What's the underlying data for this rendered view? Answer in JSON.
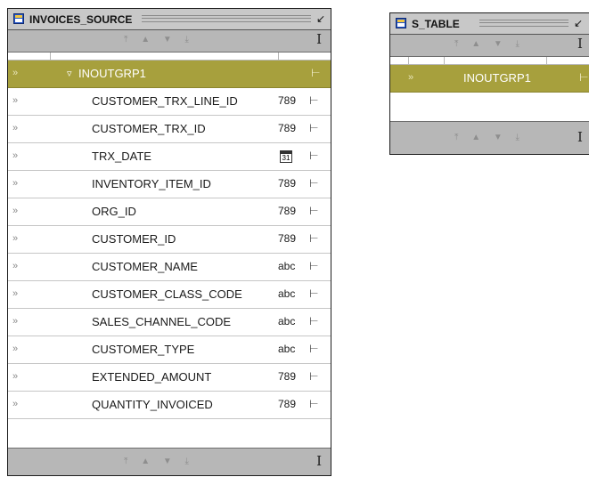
{
  "panels": {
    "invoices_source": {
      "title": "INVOICES_SOURCE",
      "nav_arrows": "⤒ ▲ ▼ ⤓",
      "cursor": "I",
      "group": {
        "toggle": "▿",
        "label": "INOUTGRP1"
      },
      "rows": [
        {
          "label": "CUSTOMER_TRX_LINE_ID",
          "type": "789"
        },
        {
          "label": "CUSTOMER_TRX_ID",
          "type": "789"
        },
        {
          "label": "TRX_DATE",
          "type": "31"
        },
        {
          "label": "INVENTORY_ITEM_ID",
          "type": "789"
        },
        {
          "label": "ORG_ID",
          "type": "789"
        },
        {
          "label": "CUSTOMER_ID",
          "type": "789"
        },
        {
          "label": "CUSTOMER_NAME",
          "type": "abc"
        },
        {
          "label": "CUSTOMER_CLASS_CODE",
          "type": "abc"
        },
        {
          "label": "SALES_CHANNEL_CODE",
          "type": "abc"
        },
        {
          "label": "CUSTOMER_TYPE",
          "type": "abc"
        },
        {
          "label": "EXTENDED_AMOUNT",
          "type": "789"
        },
        {
          "label": "QUANTITY_INVOICED",
          "type": "789"
        }
      ]
    },
    "s_table": {
      "title": "S_TABLE",
      "nav_arrows": "⤒ ▲ ▼ ⤓",
      "cursor": "I",
      "group": {
        "label": "INOUTGRP1"
      }
    }
  },
  "glyphs": {
    "row_arrow": "»",
    "minimize": "↙",
    "port": "⊢"
  },
  "colors": {
    "group_row": "#a7a03d",
    "panel_frame": "#3a3a3a",
    "titlebar": "#c8c8c8",
    "navbar": "#b7b7b7"
  }
}
